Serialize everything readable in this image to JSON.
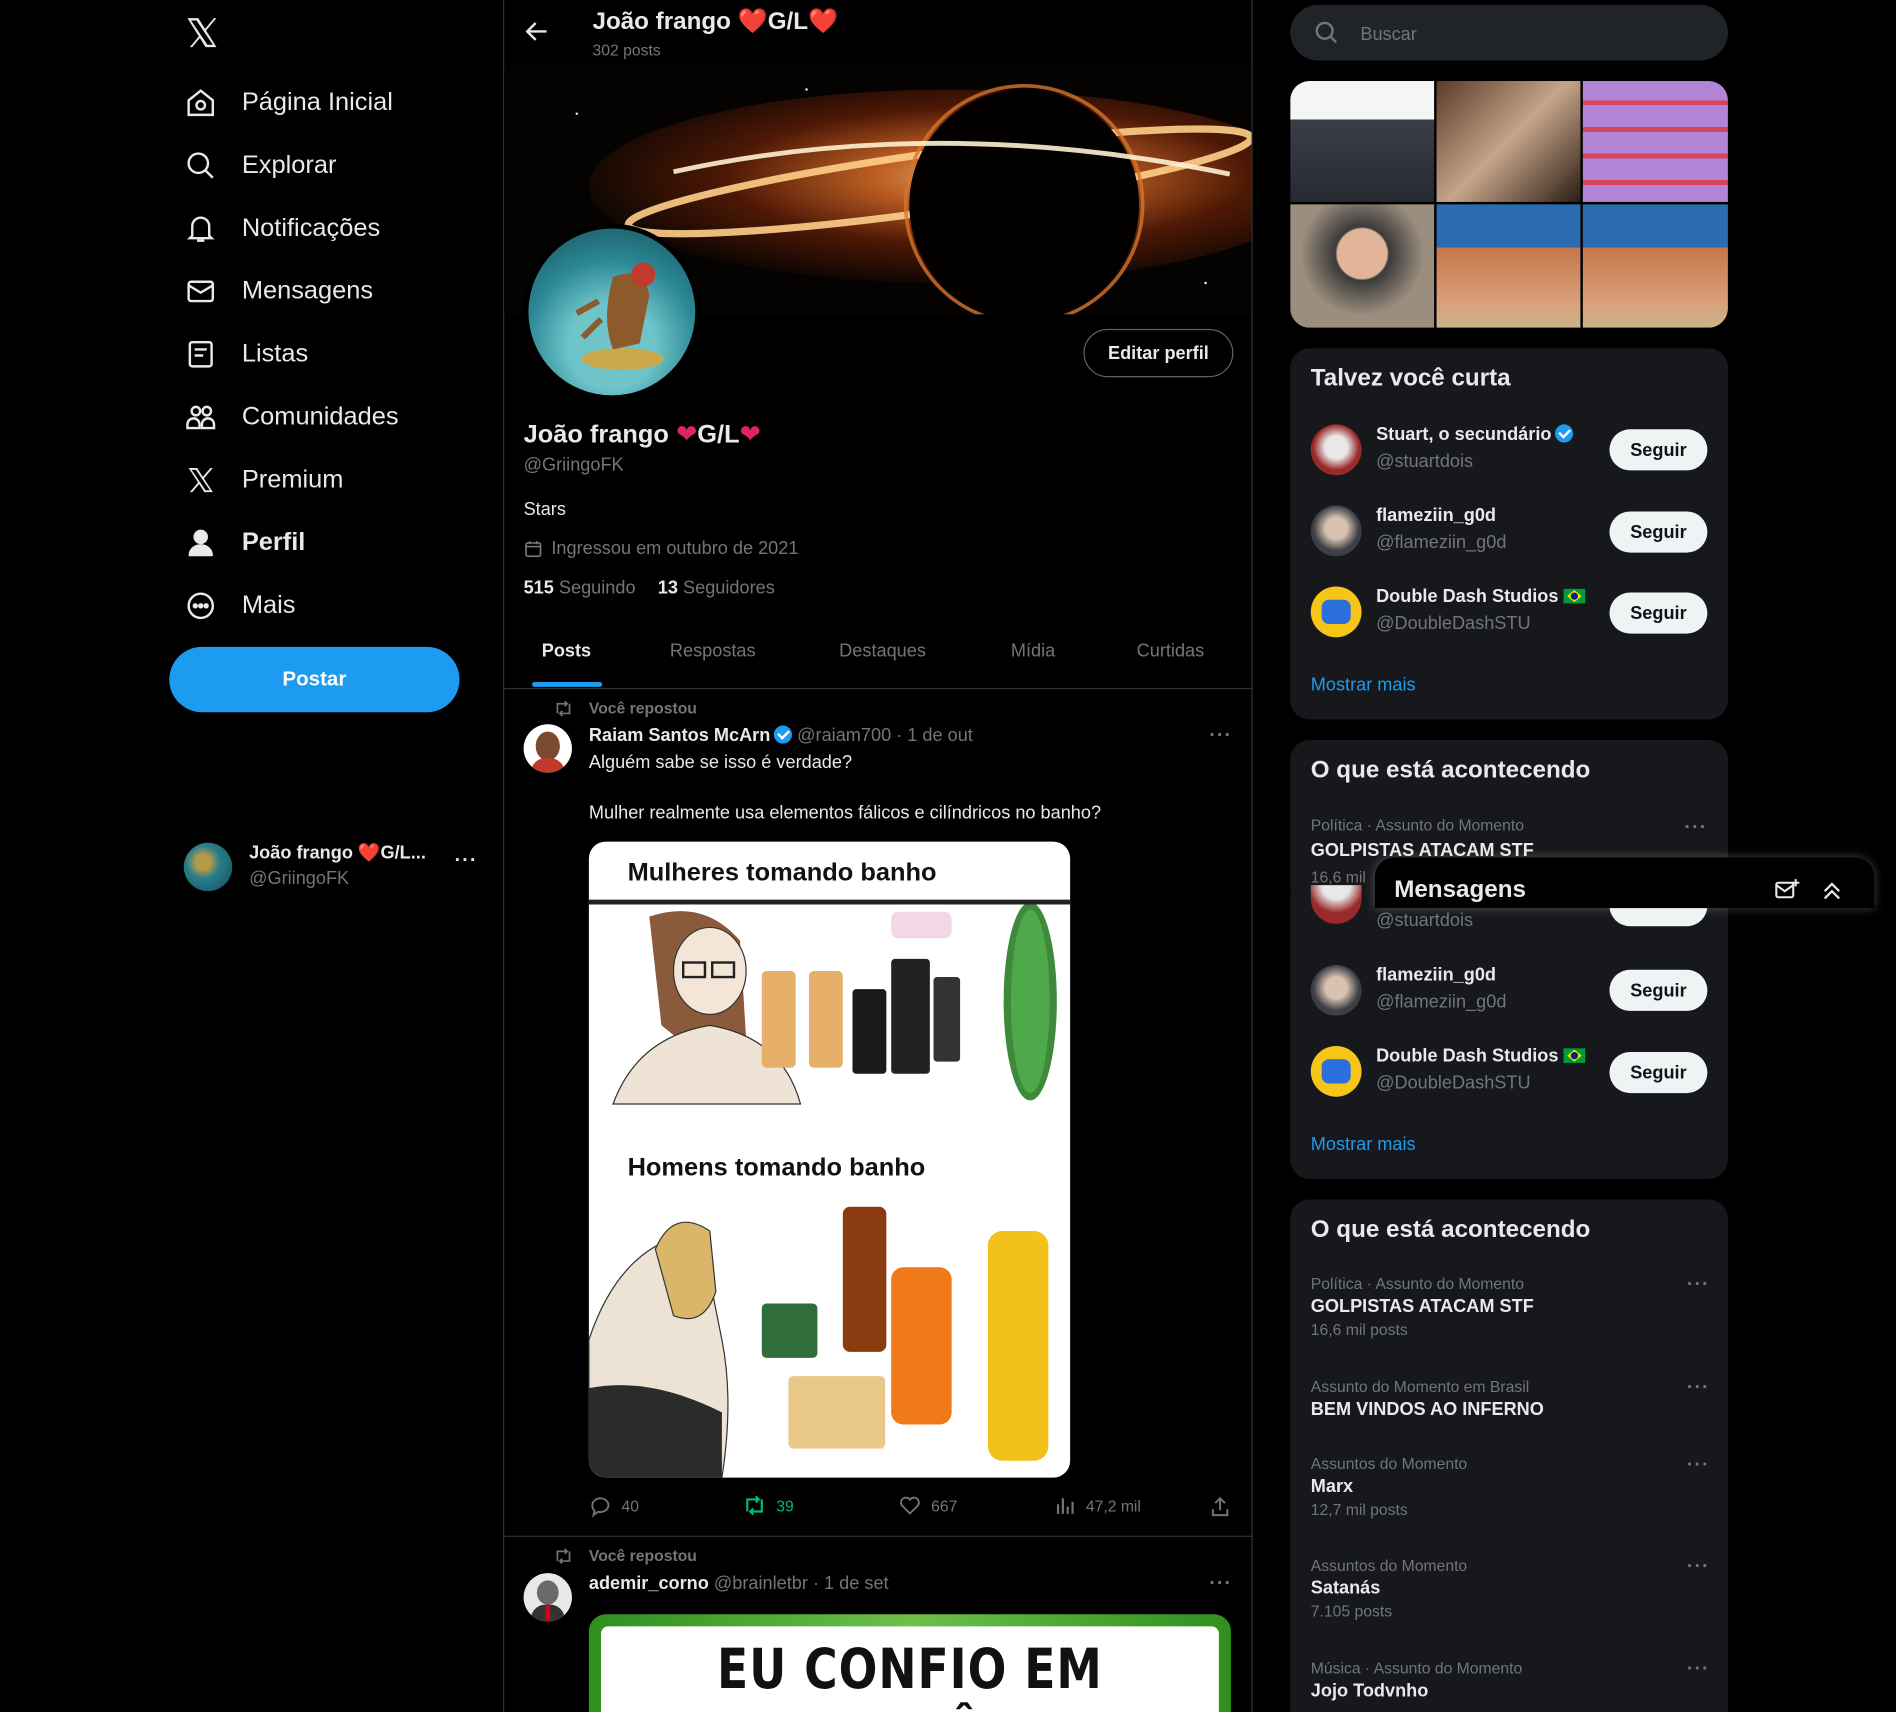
{
  "nav": {
    "items": [
      {
        "label": "Página Inicial",
        "icon": "home-icon"
      },
      {
        "label": "Explorar",
        "icon": "search-icon"
      },
      {
        "label": "Notificações",
        "icon": "bell-icon"
      },
      {
        "label": "Mensagens",
        "icon": "mail-icon"
      },
      {
        "label": "Listas",
        "icon": "list-icon"
      },
      {
        "label": "Comunidades",
        "icon": "people-icon"
      },
      {
        "label": "Premium",
        "icon": "x-logo-icon"
      },
      {
        "label": "Perfil",
        "icon": "person-icon"
      },
      {
        "label": "Mais",
        "icon": "more-circle-icon"
      }
    ],
    "post_button": "Postar",
    "account": {
      "name": "João frango ❤️G/L...",
      "handle": "@GriingoFK"
    }
  },
  "header": {
    "title": "João frango ❤️G/L❤️",
    "posts_count": "302 posts"
  },
  "profile": {
    "name_text": "João frango",
    "name_suffix": "G/L",
    "handle": "@GriingoFK",
    "bio": "Stars",
    "joined": "Ingressou em outubro de 2021",
    "following_count": "515",
    "following_label": "Seguindo",
    "followers_count": "13",
    "followers_label": "Seguidores",
    "edit_button": "Editar perfil"
  },
  "tabs": [
    "Posts",
    "Respostas",
    "Destaques",
    "Mídia",
    "Curtidas"
  ],
  "posts": [
    {
      "repost_label": "Você repostou",
      "author": "Raiam Santos McArn",
      "handle": "@raiam700",
      "time": "· 1 de out",
      "text1": "Alguém sabe se isso é verdade?",
      "text2": "Mulher realmente usa elementos fálicos e cilíndricos no banho?",
      "image_title_1": "Mulheres tomando banho",
      "image_title_2": "Homens tomando banho",
      "replies": "40",
      "reposts": "39",
      "likes": "667",
      "views": "47,2 mil"
    },
    {
      "repost_label": "Você repostou",
      "author": "ademir_corno",
      "handle": "@brainletbr",
      "time": "· 1 de set",
      "image_text": "EU CONFIO EM VOCÊ"
    }
  ],
  "search": {
    "placeholder": "Buscar"
  },
  "who_to_follow": {
    "title": "Talvez você curta",
    "users": [
      {
        "name": "Stuart, o secundário",
        "handle": "@stuartdois",
        "button": "Seguir"
      },
      {
        "name": "flameziin_g0d",
        "handle": "@flameziin_g0d",
        "button": "Seguir"
      },
      {
        "name": "Double Dash Studios",
        "handle": "@DoubleDashSTU",
        "button": "Seguir"
      }
    ],
    "show_more": "Mostrar mais"
  },
  "trends_peek": {
    "title": "O que está acontecendo",
    "meta": "Política · Assunto do Momento",
    "name": "GOLPISTAS ATACAM STF",
    "count": "16,6 mil"
  },
  "messages_drawer": {
    "title": "Mensagens"
  },
  "who_to_follow_2": {
    "users": [
      {
        "handle": "@stuartdois",
        "button": "Seguir"
      },
      {
        "name": "flameziin_g0d",
        "handle": "@flameziin_g0d",
        "button": "Seguir"
      },
      {
        "name": "Double Dash Studios",
        "handle": "@DoubleDashSTU",
        "button": "Seguir"
      }
    ],
    "show_more": "Mostrar mais"
  },
  "trends": {
    "title": "O que está acontecendo",
    "items": [
      {
        "meta": "Política · Assunto do Momento",
        "name": "GOLPISTAS ATACAM STF",
        "count": "16,6 mil posts"
      },
      {
        "meta": "Assunto do Momento em Brasil",
        "name": "BEM VINDOS AO INFERNO",
        "count": ""
      },
      {
        "meta": "Assuntos do Momento",
        "name": "Marx",
        "count": "12,7 mil posts"
      },
      {
        "meta": "Assuntos do Momento",
        "name": "Satanás",
        "count": "7.105 posts"
      },
      {
        "meta": "Música · Assunto do Momento",
        "name": "Jojo Todvnho",
        "count": ""
      }
    ]
  },
  "colors": {
    "accent": "#1d9bf0",
    "repost_green": "#00ba7c",
    "heart": "#f91880",
    "brazil_flag": "#009c3b"
  }
}
